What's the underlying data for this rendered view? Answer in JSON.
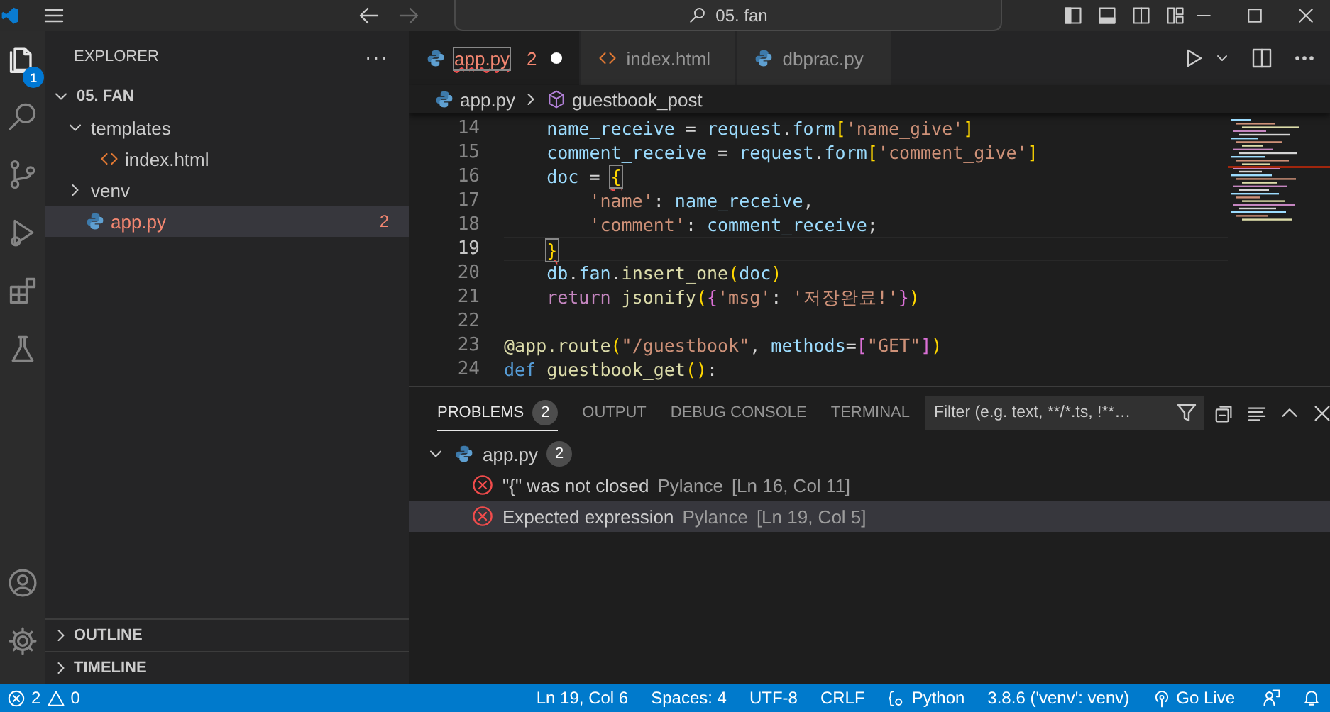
{
  "title_bar": {
    "search": "05. fan"
  },
  "activity_bar": {
    "items": [
      {
        "kind": "files",
        "selected": true,
        "badge": "1"
      },
      {
        "kind": "search",
        "selected": false
      },
      {
        "kind": "source-control",
        "selected": false
      },
      {
        "kind": "run",
        "selected": false
      },
      {
        "kind": "extensions",
        "selected": false
      },
      {
        "kind": "testing",
        "selected": false
      }
    ],
    "bottom": [
      {
        "kind": "account"
      },
      {
        "kind": "settings"
      }
    ]
  },
  "sidebar": {
    "title": "EXPLORER",
    "more": "···",
    "tree": [
      {
        "label": "05. FAN",
        "kind": "root",
        "expanded": true,
        "selected": false,
        "error": false,
        "children": [
          {
            "label": "templates",
            "kind": "folder",
            "expanded": true,
            "selected": false,
            "error": false,
            "children": [
              {
                "label": "index.html",
                "kind": "html",
                "selected": false,
                "error": false
              }
            ]
          },
          {
            "label": "venv",
            "kind": "folder",
            "expanded": false,
            "selected": false,
            "error": false
          },
          {
            "label": "app.py",
            "kind": "python",
            "selected": true,
            "error": true,
            "badge": "2"
          }
        ]
      }
    ],
    "sections": [
      {
        "label": "OUTLINE",
        "expanded": false
      },
      {
        "label": "TIMELINE",
        "expanded": false
      }
    ]
  },
  "tabs": [
    {
      "label": "app.py",
      "kind": "python",
      "selected": true,
      "error": true,
      "badge": "2",
      "modified": true
    },
    {
      "label": "index.html",
      "kind": "html",
      "selected": false,
      "error": false,
      "modified": false
    },
    {
      "label": "dbprac.py",
      "kind": "python",
      "selected": false,
      "error": false,
      "modified": false
    }
  ],
  "breadcrumb": [
    {
      "label": "app.py",
      "kind": "python"
    },
    {
      "label": "guestbook_post",
      "kind": "function"
    }
  ],
  "editor": {
    "lines": [
      {
        "number": "14",
        "current": false,
        "kind": "body",
        "tokens": [
          {
            "kind": "var",
            "text": "name_receive"
          },
          {
            "kind": "op",
            "text": " = "
          },
          {
            "kind": "var",
            "text": "request"
          },
          {
            "kind": "op",
            "text": "."
          },
          {
            "kind": "var",
            "text": "form"
          },
          {
            "kind": "b1",
            "text": "["
          },
          {
            "kind": "str",
            "text": "'name_give'"
          },
          {
            "kind": "b1",
            "text": "]"
          }
        ]
      },
      {
        "number": "15",
        "current": false,
        "kind": "body",
        "tokens": [
          {
            "kind": "var",
            "text": "comment_receive"
          },
          {
            "kind": "op",
            "text": " = "
          },
          {
            "kind": "var",
            "text": "request"
          },
          {
            "kind": "op",
            "text": "."
          },
          {
            "kind": "var",
            "text": "form"
          },
          {
            "kind": "b1",
            "text": "["
          },
          {
            "kind": "str",
            "text": "'comment_give'"
          },
          {
            "kind": "b1",
            "text": "]"
          }
        ]
      },
      {
        "number": "16",
        "current": false,
        "kind": "body",
        "tokens": [
          {
            "kind": "var",
            "text": "doc"
          },
          {
            "kind": "op",
            "text": " = "
          },
          {
            "kind": "b1-error",
            "text": "{"
          }
        ]
      },
      {
        "number": "17",
        "current": false,
        "kind": "dict",
        "tokens": [
          {
            "kind": "str",
            "text": "'name'"
          },
          {
            "kind": "op",
            "text": ": "
          },
          {
            "kind": "var",
            "text": "name_receive"
          },
          {
            "kind": "op",
            "text": ","
          }
        ]
      },
      {
        "number": "18",
        "current": false,
        "kind": "dict",
        "tokens": [
          {
            "kind": "str",
            "text": "'comment'"
          },
          {
            "kind": "op",
            "text": ": "
          },
          {
            "kind": "var",
            "text": "comment_receive"
          },
          {
            "kind": "op",
            "text": ";"
          }
        ]
      },
      {
        "number": "19",
        "current": true,
        "kind": "body",
        "tokens": [
          {
            "kind": "b1-error",
            "text": "}"
          }
        ]
      },
      {
        "number": "20",
        "current": false,
        "kind": "body",
        "tokens": [
          {
            "kind": "var",
            "text": "db"
          },
          {
            "kind": "op",
            "text": "."
          },
          {
            "kind": "var",
            "text": "fan"
          },
          {
            "kind": "op",
            "text": "."
          },
          {
            "kind": "func",
            "text": "insert_one"
          },
          {
            "kind": "b1",
            "text": "("
          },
          {
            "kind": "var",
            "text": "doc"
          },
          {
            "kind": "b1",
            "text": ")"
          }
        ]
      },
      {
        "number": "21",
        "current": false,
        "kind": "body",
        "tokens": [
          {
            "kind": "kw",
            "text": "return "
          },
          {
            "kind": "func",
            "text": "jsonify"
          },
          {
            "kind": "b1",
            "text": "("
          },
          {
            "kind": "b2",
            "text": "{"
          },
          {
            "kind": "str",
            "text": "'msg'"
          },
          {
            "kind": "op",
            "text": ": "
          },
          {
            "kind": "str",
            "text": "'저장완료!'"
          },
          {
            "kind": "b2",
            "text": "}"
          },
          {
            "kind": "b1",
            "text": ")"
          }
        ]
      },
      {
        "number": "22",
        "current": false,
        "kind": "top"
      },
      {
        "number": "23",
        "current": false,
        "kind": "top",
        "tokens": [
          {
            "kind": "func",
            "text": "@app.route"
          },
          {
            "kind": "b1",
            "text": "("
          },
          {
            "kind": "str",
            "text": "\"/guestbook\""
          },
          {
            "kind": "op",
            "text": ", "
          },
          {
            "kind": "var",
            "text": "methods"
          },
          {
            "kind": "op",
            "text": "="
          },
          {
            "kind": "b2",
            "text": "["
          },
          {
            "kind": "str",
            "text": "\"GET\""
          },
          {
            "kind": "b2",
            "text": "]"
          },
          {
            "kind": "b1",
            "text": ")"
          }
        ]
      },
      {
        "number": "24",
        "current": false,
        "kind": "top",
        "tokens": [
          {
            "kind": "kwb",
            "text": "def "
          },
          {
            "kind": "func",
            "text": "guestbook_get"
          },
          {
            "kind": "b1",
            "text": "("
          },
          {
            "kind": "b1",
            "text": ")"
          },
          {
            "kind": "op",
            "text": ":"
          }
        ]
      }
    ]
  },
  "panel": {
    "tabs": [
      {
        "label": "PROBLEMS",
        "selected": true,
        "badge": "2"
      },
      {
        "label": "OUTPUT",
        "selected": false
      },
      {
        "label": "DEBUG CONSOLE",
        "selected": false
      },
      {
        "label": "TERMINAL",
        "selected": false
      }
    ],
    "filter": {
      "placeholder": "Filter (e.g. text, **/*.ts, !**…"
    },
    "file": {
      "label": "app.py",
      "badge": "2",
      "expanded": true
    },
    "problems": [
      {
        "message": "\"{\" was not closed",
        "source": "Pylance",
        "location": "[Ln 16, Col 11]",
        "selected": false
      },
      {
        "message": "Expected expression",
        "source": "Pylance",
        "location": "[Ln 19, Col 5]",
        "selected": true
      }
    ]
  },
  "status_bar": {
    "errors": "2",
    "warnings": "0",
    "right": [
      {
        "kind": "text",
        "text": "Ln 19, Col 6"
      },
      {
        "kind": "text",
        "text": "Spaces: 4"
      },
      {
        "kind": "text",
        "text": "UTF-8"
      },
      {
        "kind": "text",
        "text": "CRLF"
      },
      {
        "kind": "language",
        "text": "Python"
      },
      {
        "kind": "text",
        "text": "3.8.6 ('venv': venv)"
      },
      {
        "kind": "live",
        "text": "Go Live"
      },
      {
        "kind": "feedback"
      },
      {
        "kind": "bell"
      }
    ]
  }
}
